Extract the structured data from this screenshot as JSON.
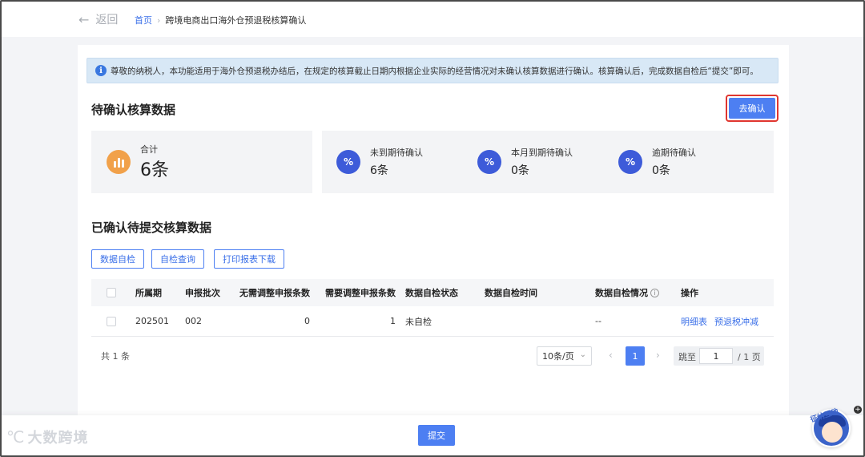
{
  "nav": {
    "back_label": "返回",
    "breadcrumb_home": "首页",
    "breadcrumb_current": "跨境电商出口海外仓预退税核算确认"
  },
  "notice": {
    "text": "尊敬的纳税人，本功能适用于海外仓预退税办结后，在规定的核算截止日期内根据企业实际的经营情况对未确认核算数据进行确认。核算确认后，完成数据自检后“提交”即可。"
  },
  "pending": {
    "title": "待确认核算数据",
    "confirm_button": "去确认",
    "total": {
      "label": "合计",
      "value": "6条"
    },
    "stats": [
      {
        "label": "未到期待确认",
        "value": "6条"
      },
      {
        "label": "本月到期待确认",
        "value": "0条"
      },
      {
        "label": "逾期待确认",
        "value": "0条"
      }
    ]
  },
  "confirmed": {
    "title": "已确认待提交核算数据",
    "buttons": {
      "self_check": "数据自检",
      "check_query": "自检查询",
      "print_download": "打印报表下载"
    }
  },
  "table": {
    "headers": {
      "period": "所属期",
      "batch": "申报批次",
      "no_adjust": "无需调整申报条数",
      "need_adjust": "需要调整申报条数",
      "check_status": "数据自检状态",
      "check_time": "数据自检时间",
      "check_result": "数据自检情况",
      "actions": "操作"
    },
    "rows": [
      {
        "period": "202501",
        "batch": "002",
        "no_adjust": "0",
        "need_adjust": "1",
        "check_status": "未自检",
        "check_time": "",
        "check_result": "--",
        "action_detail": "明细表",
        "action_offset": "预退税冲减"
      }
    ]
  },
  "pagination": {
    "total_text": "共 1 条",
    "page_size": "10条/页",
    "current_page": "1",
    "jump_label": "跳至",
    "jump_value": "1",
    "page_total": "/ 1 页"
  },
  "footer": {
    "submit_label": "提交",
    "watermark": "大数跨境",
    "assistant_label": "征纳互动"
  },
  "colors": {
    "primary": "#4d7ff2",
    "highlight_border": "#e0362f",
    "notice_bg": "#d8e8f6",
    "orange_icon": "#f1a14a",
    "blue_icon": "#3d5bd9"
  }
}
